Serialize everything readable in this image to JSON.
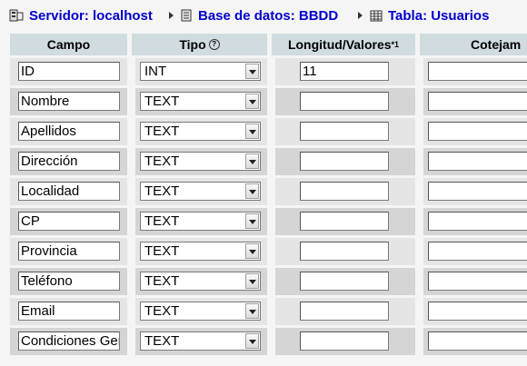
{
  "breadcrumb": {
    "server": "Servidor: localhost",
    "database": "Base de datos: BBDD",
    "table": "Tabla: Usuarios"
  },
  "headers": {
    "campo": "Campo",
    "tipo": "Tipo",
    "longitud": "Longitud/Valores",
    "longitud_note": "*1",
    "cotejamiento": "Cotejam"
  },
  "rows": [
    {
      "campo": "ID",
      "tipo": "INT",
      "longitud": "11",
      "cotejamiento": ""
    },
    {
      "campo": "Nombre",
      "tipo": "TEXT",
      "longitud": "",
      "cotejamiento": ""
    },
    {
      "campo": "Apellidos",
      "tipo": "TEXT",
      "longitud": "",
      "cotejamiento": ""
    },
    {
      "campo": "Dirección",
      "tipo": "TEXT",
      "longitud": "",
      "cotejamiento": ""
    },
    {
      "campo": "Localidad",
      "tipo": "TEXT",
      "longitud": "",
      "cotejamiento": ""
    },
    {
      "campo": "CP",
      "tipo": "TEXT",
      "longitud": "",
      "cotejamiento": ""
    },
    {
      "campo": "Provincia",
      "tipo": "TEXT",
      "longitud": "",
      "cotejamiento": ""
    },
    {
      "campo": "Teléfono",
      "tipo": "TEXT",
      "longitud": "",
      "cotejamiento": ""
    },
    {
      "campo": "Email",
      "tipo": "TEXT",
      "longitud": "",
      "cotejamiento": ""
    },
    {
      "campo": "Condiciones Generales",
      "tipo": "TEXT",
      "longitud": "",
      "cotejamiento": ""
    }
  ],
  "colors": {
    "link": "#0000cc",
    "header_bg": "#d0dce0",
    "row_odd": "#e5e5e5",
    "row_even": "#d5d5d5"
  }
}
